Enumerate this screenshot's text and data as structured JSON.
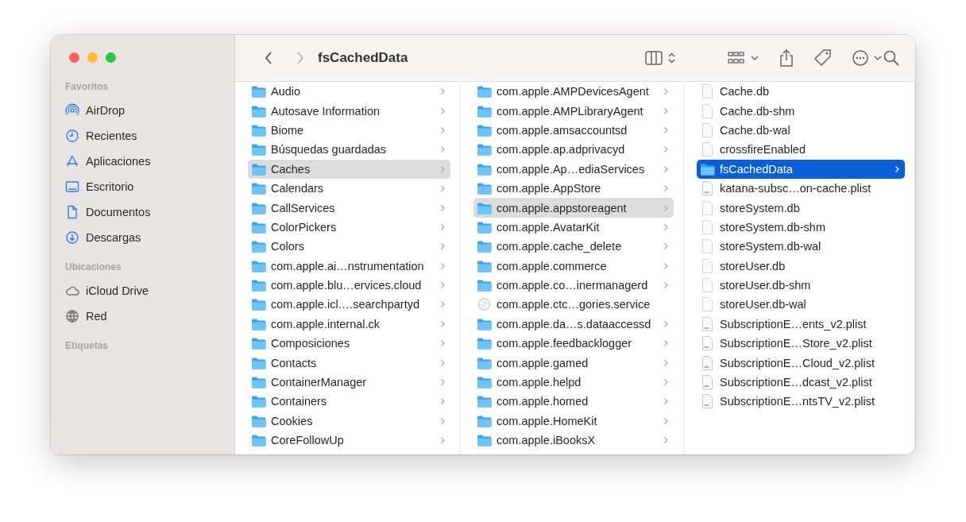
{
  "toolbar": {
    "title": "fsCachedData",
    "back_disabled": false,
    "forward_disabled": true
  },
  "sidebar": {
    "sections": [
      {
        "title": "Favoritos",
        "items": [
          {
            "label": "AirDrop",
            "kind": "airdrop",
            "selected": false
          },
          {
            "label": "Recientes",
            "kind": "clock",
            "selected": false
          },
          {
            "label": "Aplicaciones",
            "kind": "apps",
            "selected": false
          },
          {
            "label": "Escritorio",
            "kind": "desktop",
            "selected": false
          },
          {
            "label": "Documentos",
            "kind": "document",
            "selected": false
          },
          {
            "label": "Descargas",
            "kind": "download",
            "selected": false
          }
        ]
      },
      {
        "title": "Ubicaciones",
        "items": [
          {
            "label": "iCloud Drive",
            "kind": "cloud",
            "selected": false
          },
          {
            "label": "Red",
            "kind": "globe",
            "selected": false
          }
        ]
      },
      {
        "title": "Etiquetas"
      }
    ]
  },
  "columns": [
    {
      "active": false,
      "items": [
        {
          "name": "Audio",
          "kind": "folder",
          "selected": false
        },
        {
          "name": "Autosave Information",
          "kind": "folder",
          "selected": false
        },
        {
          "name": "Biome",
          "kind": "folder",
          "selected": false
        },
        {
          "name": "Búsquedas guardadas",
          "kind": "folder",
          "selected": false
        },
        {
          "name": "Caches",
          "kind": "folder",
          "selected": true
        },
        {
          "name": "Calendars",
          "kind": "folder",
          "selected": false
        },
        {
          "name": "CallServices",
          "kind": "folder",
          "selected": false
        },
        {
          "name": "ColorPickers",
          "kind": "folder",
          "selected": false
        },
        {
          "name": "Colors",
          "kind": "folder",
          "selected": false
        },
        {
          "name": "com.apple.ai…nstrumentation",
          "kind": "folder",
          "selected": false
        },
        {
          "name": "com.apple.blu…ervices.cloud",
          "kind": "folder",
          "selected": false
        },
        {
          "name": "com.apple.icl….searchpartyd",
          "kind": "folder",
          "selected": false
        },
        {
          "name": "com.apple.internal.ck",
          "kind": "folder",
          "selected": false
        },
        {
          "name": "Composiciones",
          "kind": "folder",
          "selected": false
        },
        {
          "name": "Contacts",
          "kind": "folder",
          "selected": false
        },
        {
          "name": "ContainerManager",
          "kind": "folder",
          "selected": false
        },
        {
          "name": "Containers",
          "kind": "folder",
          "selected": false
        },
        {
          "name": "Cookies",
          "kind": "folder",
          "selected": false
        },
        {
          "name": "CoreFollowUp",
          "kind": "folder",
          "selected": false
        }
      ]
    },
    {
      "active": false,
      "items": [
        {
          "name": "com.apple.AMPDevicesAgent",
          "kind": "folder",
          "selected": false
        },
        {
          "name": "com.apple.AMPLibraryAgent",
          "kind": "folder",
          "selected": false
        },
        {
          "name": "com.apple.amsaccountsd",
          "kind": "folder",
          "selected": false
        },
        {
          "name": "com.apple.ap.adprivacyd",
          "kind": "folder",
          "selected": false
        },
        {
          "name": "com.apple.Ap…ediaServices",
          "kind": "folder",
          "selected": false
        },
        {
          "name": "com.apple.AppStore",
          "kind": "folder",
          "selected": false
        },
        {
          "name": "com.apple.appstoreagent",
          "kind": "folder",
          "selected": true
        },
        {
          "name": "com.apple.AvatarKit",
          "kind": "folder",
          "selected": false
        },
        {
          "name": "com.apple.cache_delete",
          "kind": "folder",
          "selected": false
        },
        {
          "name": "com.apple.commerce",
          "kind": "folder",
          "selected": false
        },
        {
          "name": "com.apple.co…inermanagerd",
          "kind": "folder",
          "selected": false
        },
        {
          "name": "com.apple.ctc…gories.service",
          "kind": "app",
          "selected": false
        },
        {
          "name": "com.apple.da…s.dataaccessd",
          "kind": "folder",
          "selected": false
        },
        {
          "name": "com.apple.feedbacklogger",
          "kind": "folder",
          "selected": false
        },
        {
          "name": "com.apple.gamed",
          "kind": "folder",
          "selected": false
        },
        {
          "name": "com.apple.helpd",
          "kind": "folder",
          "selected": false
        },
        {
          "name": "com.apple.homed",
          "kind": "folder",
          "selected": false
        },
        {
          "name": "com.apple.HomeKit",
          "kind": "folder",
          "selected": false
        },
        {
          "name": "com.apple.iBooksX",
          "kind": "folder",
          "selected": false
        }
      ]
    },
    {
      "active": true,
      "items": [
        {
          "name": "Cache.db",
          "kind": "file",
          "selected": false
        },
        {
          "name": "Cache.db-shm",
          "kind": "file",
          "selected": false
        },
        {
          "name": "Cache.db-wal",
          "kind": "file",
          "selected": false
        },
        {
          "name": "crossfireEnabled",
          "kind": "file",
          "selected": false
        },
        {
          "name": "fsCachedData",
          "kind": "folder",
          "selected": true
        },
        {
          "name": "katana-subsc…on-cache.plist",
          "kind": "plist",
          "selected": false
        },
        {
          "name": "storeSystem.db",
          "kind": "file",
          "selected": false
        },
        {
          "name": "storeSystem.db-shm",
          "kind": "file",
          "selected": false
        },
        {
          "name": "storeSystem.db-wal",
          "kind": "file",
          "selected": false
        },
        {
          "name": "storeUser.db",
          "kind": "file",
          "selected": false
        },
        {
          "name": "storeUser.db-shm",
          "kind": "file",
          "selected": false
        },
        {
          "name": "storeUser.db-wal",
          "kind": "file",
          "selected": false
        },
        {
          "name": "SubscriptionE…ents_v2.plist",
          "kind": "plist",
          "selected": false
        },
        {
          "name": "SubscriptionE…Store_v2.plist",
          "kind": "plist",
          "selected": false
        },
        {
          "name": "SubscriptionE…Cloud_v2.plist",
          "kind": "plist",
          "selected": false
        },
        {
          "name": "SubscriptionE…dcast_v2.plist",
          "kind": "plist",
          "selected": false
        },
        {
          "name": "SubscriptionE…ntsTV_v2.plist",
          "kind": "plist",
          "selected": false
        }
      ]
    }
  ]
}
